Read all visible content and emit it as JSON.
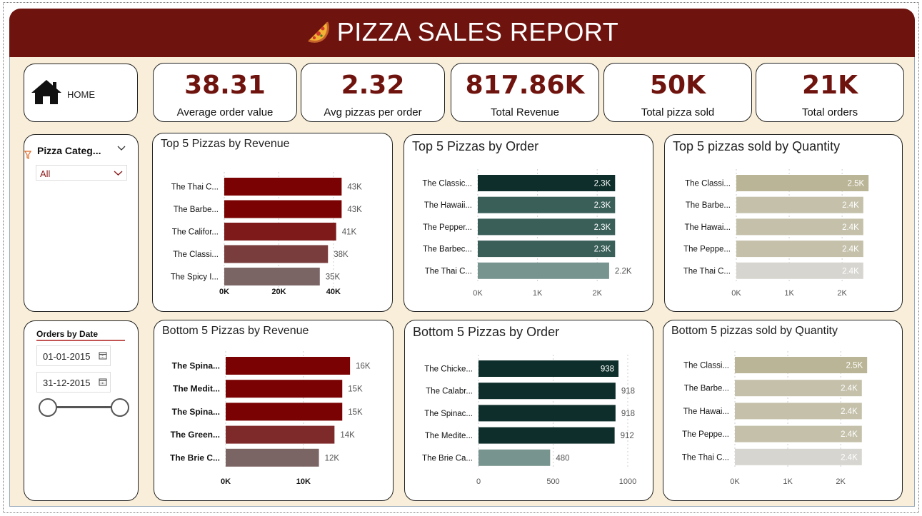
{
  "header": {
    "title": "PIZZA SALES REPORT",
    "icon": "pizza-icon"
  },
  "home": {
    "label": "HOME",
    "icon": "home-icon"
  },
  "kpis": [
    {
      "value": "38.31",
      "label": "Average order value"
    },
    {
      "value": "2.32",
      "label": "Avg pizzas per order"
    },
    {
      "value": "817.86K",
      "label": "Total Revenue"
    },
    {
      "value": "50K",
      "label": "Total pizza sold"
    },
    {
      "value": "21K",
      "label": "Total orders"
    }
  ],
  "category_slicer": {
    "title": "Pizza Categ...",
    "selected": "All"
  },
  "date_slicer": {
    "title": "Orders by Date",
    "start": "01-01-2015",
    "end": "31-12-2015"
  },
  "colors": {
    "brand": "#6f130e",
    "background": "#f8eed9"
  },
  "chart_data": [
    {
      "id": "top-revenue",
      "type": "bar",
      "title": "Top 5 Pizzas by Revenue",
      "categories": [
        "The Thai C...",
        "The Barbe...",
        "The Califor...",
        "The Classi...",
        "The Spicy I..."
      ],
      "values": [
        43,
        43,
        41,
        38,
        35
      ],
      "value_labels": [
        "43K",
        "43K",
        "41K",
        "38K",
        "35K"
      ],
      "label_inside": [
        false,
        false,
        false,
        false,
        false
      ],
      "colors": [
        "#7a0202",
        "#7a0202",
        "#7e1a1a",
        "#7a3d3d",
        "#7b6464"
      ],
      "ticks": [
        "0K",
        "20K",
        "40K"
      ],
      "tick_values": [
        0,
        20,
        40
      ],
      "xlim": [
        0,
        45
      ]
    },
    {
      "id": "top-orders",
      "type": "bar",
      "title": "Top 5 Pizzas by Order",
      "categories": [
        "The Classic...",
        "The Hawaii...",
        "The Pepper...",
        "The Barbec...",
        "The Thai C..."
      ],
      "values": [
        2.3,
        2.3,
        2.3,
        2.3,
        2.2
      ],
      "value_labels": [
        "2.3K",
        "2.3K",
        "2.3K",
        "2.3K",
        "2.2K"
      ],
      "label_inside": [
        true,
        true,
        true,
        true,
        false
      ],
      "colors": [
        "#0d2e2a",
        "#3a5f59",
        "#3a5f59",
        "#3a5f59",
        "#78948f"
      ],
      "ticks": [
        "0K",
        "1K",
        "2K"
      ],
      "tick_values": [
        0,
        1,
        2
      ],
      "xlim": [
        0,
        2.5
      ]
    },
    {
      "id": "top-quantity",
      "type": "bar",
      "title": "Top 5 pizzas sold by Quantity",
      "categories": [
        "The Classi...",
        "The Barbe...",
        "The Hawai...",
        "The Peppe...",
        "The Thai C..."
      ],
      "values": [
        2.5,
        2.4,
        2.4,
        2.4,
        2.4
      ],
      "value_labels": [
        "2.5K",
        "2.4K",
        "2.4K",
        "2.4K",
        "2.4K"
      ],
      "label_inside": [
        true,
        true,
        true,
        true,
        true
      ],
      "colors": [
        "#bab596",
        "#c4c0aa",
        "#c4c0aa",
        "#c4c0aa",
        "#d6d5d0"
      ],
      "ticks": [
        "0K",
        "1K",
        "2K"
      ],
      "tick_values": [
        0,
        1,
        2
      ],
      "xlim": [
        0,
        2.7
      ]
    },
    {
      "id": "bottom-revenue",
      "type": "bar",
      "title": "Bottom 5 Pizzas by Revenue",
      "categories": [
        "The Spina...",
        "The Medit...",
        "The Spina...",
        "The Green...",
        "The Brie C..."
      ],
      "values": [
        16,
        15,
        15,
        14,
        12
      ],
      "value_labels": [
        "16K",
        "15K",
        "15K",
        "14K",
        "12K"
      ],
      "label_inside": [
        false,
        false,
        false,
        false,
        false
      ],
      "colors": [
        "#7a0202",
        "#7a0202",
        "#7a0202",
        "#7e2a2a",
        "#7b6464"
      ],
      "ticks": [
        "0K",
        "10K"
      ],
      "tick_values": [
        0,
        10
      ],
      "xlim": [
        0,
        17
      ]
    },
    {
      "id": "bottom-orders",
      "type": "bar",
      "title": "Bottom 5 Pizzas by Order",
      "categories": [
        "The Chicke...",
        "The Calabr...",
        "The Spinac...",
        "The Medite...",
        "The Brie Ca..."
      ],
      "values": [
        938,
        918,
        918,
        912,
        480
      ],
      "value_labels": [
        "938",
        "918",
        "918",
        "912",
        "480"
      ],
      "label_inside": [
        true,
        false,
        false,
        false,
        false
      ],
      "colors": [
        "#0d2e2a",
        "#0d2e2a",
        "#0d2e2a",
        "#0d2e2a",
        "#78948f"
      ],
      "ticks": [
        "0",
        "500",
        "1000"
      ],
      "tick_values": [
        0,
        500,
        1000
      ],
      "xlim": [
        0,
        1000
      ]
    },
    {
      "id": "bottom-quantity",
      "type": "bar",
      "title": "Bottom 5 pizzas sold by Quantity",
      "categories": [
        "The Classi...",
        "The Barbe...",
        "The Hawai...",
        "The Peppe...",
        "The Thai C..."
      ],
      "values": [
        2.5,
        2.4,
        2.4,
        2.4,
        2.4
      ],
      "value_labels": [
        "2.5K",
        "2.4K",
        "2.4K",
        "2.4K",
        "2.4K"
      ],
      "label_inside": [
        true,
        true,
        true,
        true,
        true
      ],
      "colors": [
        "#bab596",
        "#c4c0aa",
        "#c4c0aa",
        "#c4c0aa",
        "#d6d5d0"
      ],
      "ticks": [
        "0K",
        "1K",
        "2K"
      ],
      "tick_values": [
        0,
        1,
        2
      ],
      "xlim": [
        0,
        2.7
      ]
    }
  ]
}
